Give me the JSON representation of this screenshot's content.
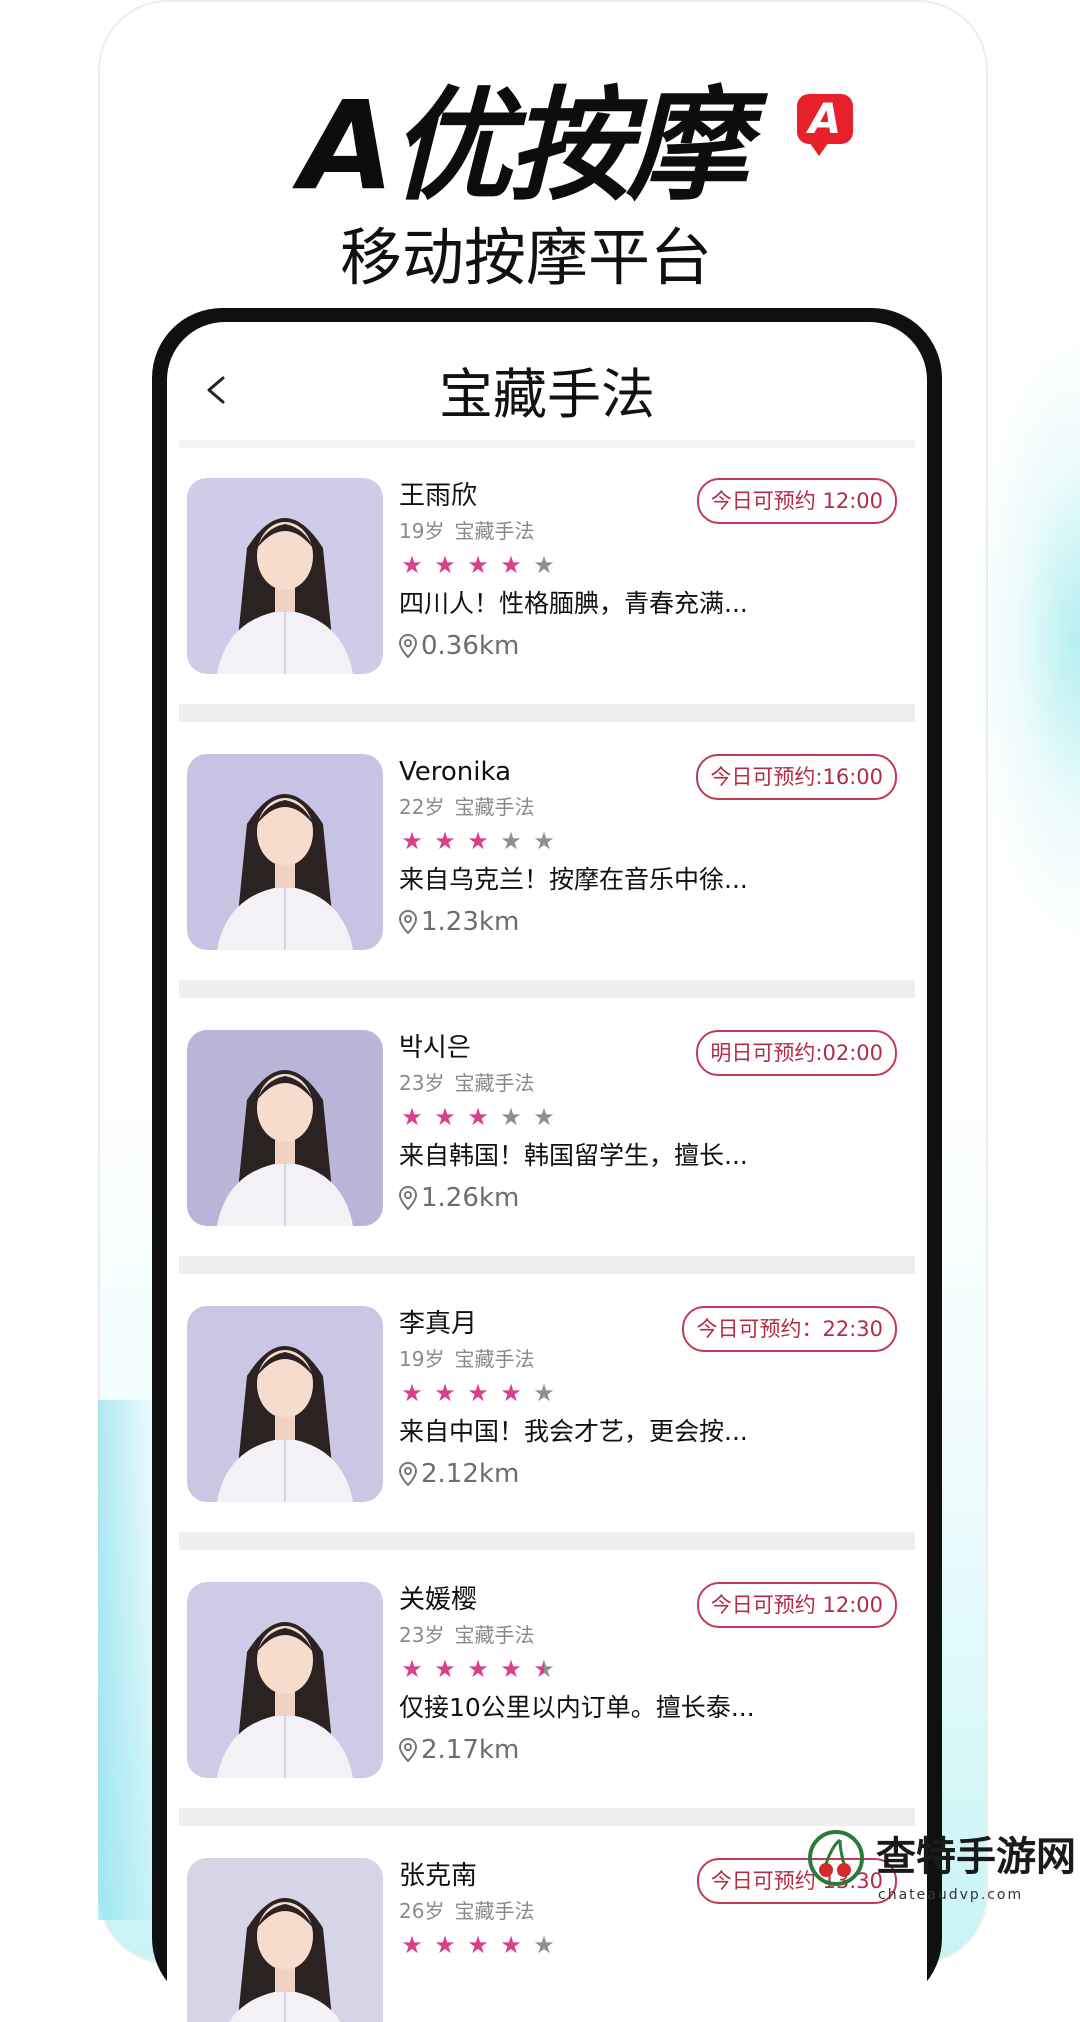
{
  "brand": {
    "title": "A优按摩",
    "logo_letter": "A",
    "subtitle": "移动按摩平台",
    "accent": "#e8202a"
  },
  "nav": {
    "back_icon": "chevron-left-icon",
    "title": "宝藏手法"
  },
  "colors": {
    "badge": "#b22c46",
    "star_on": "#d8408c",
    "star_off": "#8e8e96"
  },
  "therapists": [
    {
      "name": "王雨欣",
      "age": "19岁",
      "tag": "宝藏手法",
      "rating": 4,
      "desc": "四川人！性格腼腆，青春充满...",
      "distance": "0.36km",
      "badge": "今日可预约 12:00"
    },
    {
      "name": "Veronika",
      "age": "22岁",
      "tag": "宝藏手法",
      "rating": 3,
      "desc": "来自乌克兰！按摩在音乐中徐...",
      "distance": "1.23km",
      "badge": "今日可预约:16:00"
    },
    {
      "name": "박시은",
      "age": "23岁",
      "tag": "宝藏手法",
      "rating": 3,
      "desc": "来自韩国！韩国留学生，擅长...",
      "distance": "1.26km",
      "badge": "明日可预约:02:00"
    },
    {
      "name": "李真月",
      "age": "19岁",
      "tag": "宝藏手法",
      "rating": 4,
      "desc": "来自中国！我会才艺，更会按...",
      "distance": "2.12km",
      "badge": "今日可预约：22:30"
    },
    {
      "name": "关媛樱",
      "age": "23岁",
      "tag": "宝藏手法",
      "rating": 4.5,
      "desc": "仅接10公里以内订单。擅长泰...",
      "distance": "2.17km",
      "badge": "今日可预约 12:00"
    },
    {
      "name": "张克南",
      "age": "26岁",
      "tag": "宝藏手法",
      "rating": 4,
      "desc": "",
      "distance": "",
      "badge": "今日可预约 13:30"
    }
  ],
  "watermark": {
    "text": "查特手游网",
    "url": "chateaudvp.com"
  }
}
